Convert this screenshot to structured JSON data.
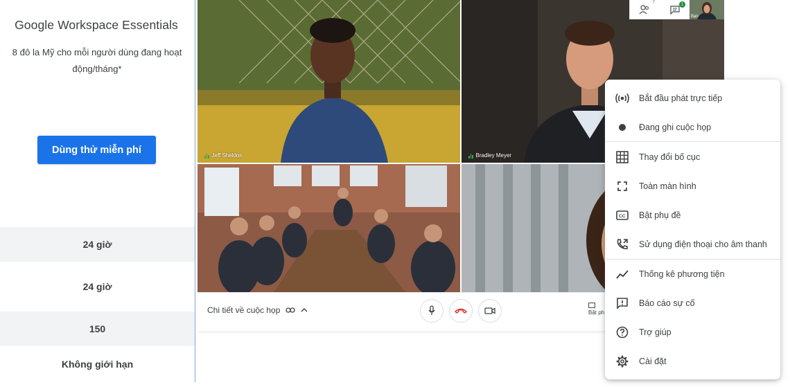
{
  "pricing": {
    "plan_name": "Google Workspace Essentials",
    "price_line1": "8 đô la Mỹ cho mỗi người dùng đang hoạt",
    "price_line2": "động/tháng*",
    "cta_label": "Dùng thử miễn phí",
    "features": [
      "24 giờ",
      "24 giờ",
      "150",
      "Không giới hạn"
    ]
  },
  "meet": {
    "tiles": [
      {
        "name": "Jeff Sheldon"
      },
      {
        "name": "Bradley Meyer"
      }
    ],
    "top_strip": {
      "people_count": "7",
      "chat_badge": "1",
      "self_label": "Bạn"
    },
    "bottom_bar": {
      "meeting_details": "Chi tiết về cuộc họp",
      "captions_short": "Bật ph"
    }
  },
  "menu": {
    "items": [
      {
        "label": "Bắt đầu phát trực tiếp",
        "icon": "broadcast-icon"
      },
      {
        "label": "Đang ghi cuộc họp",
        "icon": "record-dot-icon"
      },
      {
        "label": "Thay đổi bố cục",
        "icon": "grid-layout-icon"
      },
      {
        "label": "Toàn màn hình",
        "icon": "fullscreen-icon"
      },
      {
        "label": "Bật phụ đề",
        "icon": "closed-captions-icon"
      },
      {
        "label": "Sử dụng điện thoại cho âm thanh",
        "icon": "phone-forward-icon"
      },
      {
        "label": "Thống kê phương tiện",
        "icon": "stats-line-icon"
      },
      {
        "label": "Báo cáo sự cố",
        "icon": "report-issue-icon"
      },
      {
        "label": "Trợ giúp",
        "icon": "help-icon"
      },
      {
        "label": "Cài đặt",
        "icon": "settings-gear-icon"
      }
    ]
  },
  "colors": {
    "accent_blue": "#1a73e8",
    "hangup_red": "#d93025",
    "speaking_green": "#34a853",
    "row_shade": "#f1f3f4"
  }
}
